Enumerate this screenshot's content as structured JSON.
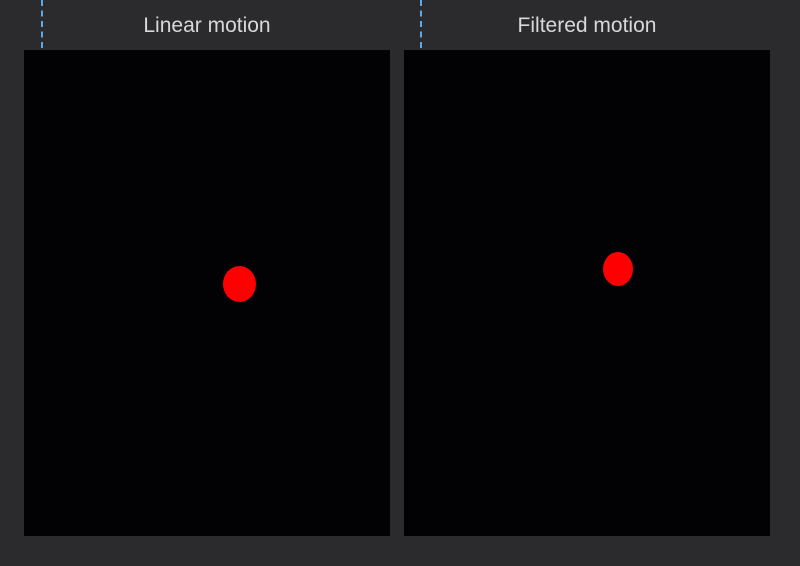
{
  "panels": [
    {
      "title": "Linear motion",
      "dot_color": "#ff0000"
    },
    {
      "title": "Filtered motion",
      "dot_color": "#ff0000"
    }
  ],
  "colors": {
    "background": "#2b2a2d",
    "canvas": "#020104",
    "guide": "#5aa9e8",
    "title_text": "#d8d8d8"
  }
}
